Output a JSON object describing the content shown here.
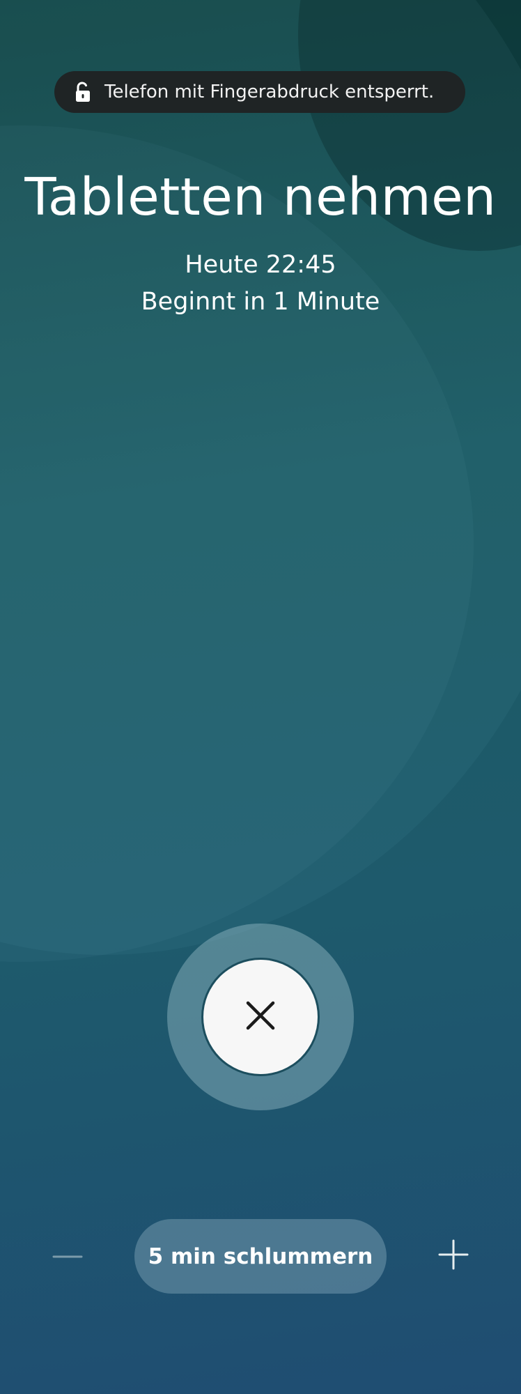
{
  "toast": {
    "icon": "unlock-icon",
    "text": "Telefon mit Fingerabdruck entsperrt."
  },
  "alarm": {
    "title": "Tabletten nehmen",
    "time": "Heute 22:45",
    "starts_in": "Beginnt in 1 Minute"
  },
  "dismiss": {
    "icon": "close-icon"
  },
  "snooze": {
    "label": "5 min schlummern",
    "decrease_icon": "minus-icon",
    "increase_icon": "plus-icon"
  },
  "colors": {
    "background_top": "#134646",
    "background_bottom": "#1f4d72",
    "toast_bg": "#1f2425",
    "dismiss_bg": "#f7f7f7"
  }
}
